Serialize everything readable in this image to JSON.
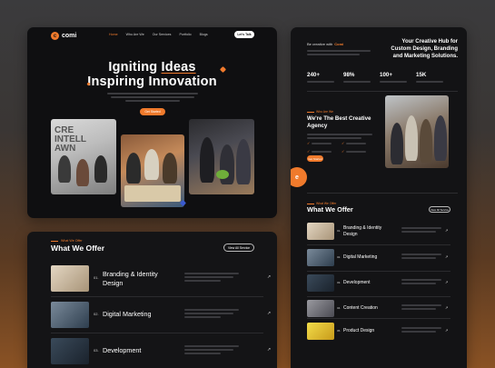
{
  "hero": {
    "logo": "comi",
    "logo_mark": "c",
    "nav": [
      "Home",
      "Who Are We",
      "Our Services",
      "Portfolio",
      "Blogs"
    ],
    "cta": "Let's Talk",
    "title_line1_a": "Igniting ",
    "title_line1_b": "Ideas",
    "title_line2": "Inspiring Innovation",
    "button": "Get Started"
  },
  "offer": {
    "kicker": "What We Offer",
    "title": "What We Offer",
    "view_all": "View All Service",
    "rows": [
      {
        "num": "01.",
        "name": "Branding & Identity Design",
        "thumb_color": "#c9b9a6"
      },
      {
        "num": "02.",
        "name": "Digital Marketing",
        "thumb_color": "#5a6a7a"
      },
      {
        "num": "03.",
        "name": "Development",
        "thumb_color": "#2e3a48"
      }
    ]
  },
  "right": {
    "tag_prefix": "Be creative with ",
    "tag_brand": "Comi",
    "headline": "Your Creative Hub for Custom Design, Branding and Marketing Solutions.",
    "stats": [
      {
        "value": "240+"
      },
      {
        "value": "98%"
      },
      {
        "value": "100+"
      },
      {
        "value": "15K"
      }
    ],
    "agency_kicker": "Who Are We",
    "agency_title": "We're The Best Creative Agency",
    "checks": [
      "",
      "",
      "",
      ""
    ],
    "agency_button": "Get Started",
    "badge": "e",
    "offer_kicker": "What We Offer",
    "offer_title": "What We Offer",
    "view_all": "View All Service",
    "rows": [
      {
        "num": "01.",
        "name": "Branding & Identity Design",
        "thumb_color": "#c9b9a6"
      },
      {
        "num": "02.",
        "name": "Digital Marketing",
        "thumb_color": "#5a6a7a"
      },
      {
        "num": "03.",
        "name": "Development",
        "thumb_color": "#2e3a48"
      },
      {
        "num": "04.",
        "name": "Content Creation",
        "thumb_color": "#6b6b70"
      },
      {
        "num": "05.",
        "name": "Product Design",
        "thumb_color": "#e0c030"
      }
    ]
  },
  "colors": {
    "accent": "#f07a2c",
    "card": "#131315"
  }
}
